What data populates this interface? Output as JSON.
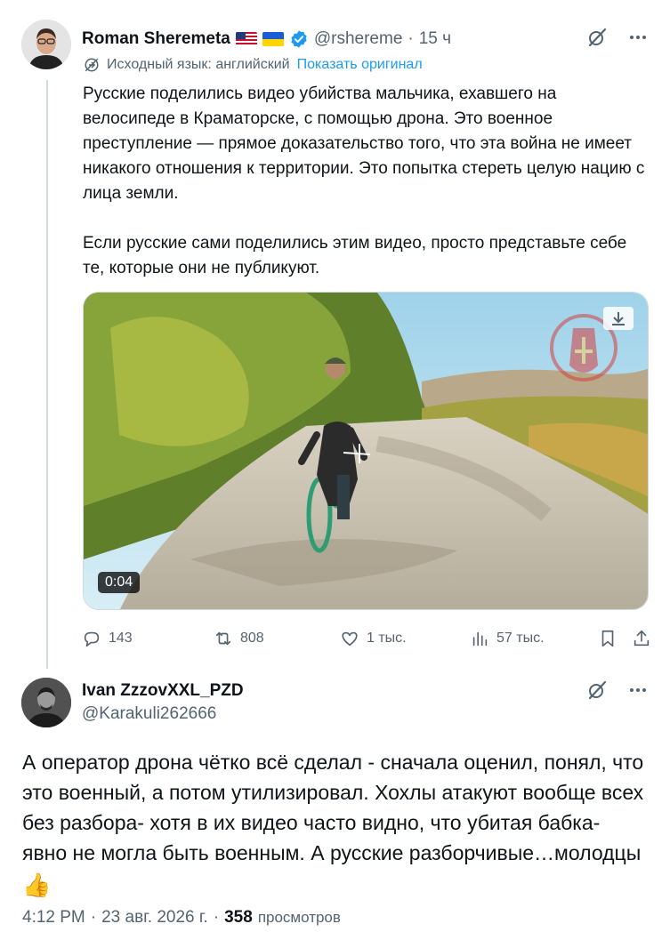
{
  "tweet": {
    "author_name": "Roman Sheremeta",
    "handle": "@rshereme",
    "separator": "·",
    "time_ago": "15 ч",
    "translation_note": "Исходный язык: английский",
    "show_original": "Показать оригинал",
    "paragraphs": [
      "Русские поделились видео убийства мальчика, ехавшего на велосипеде в Краматорске, с помощью дрона. Это военное преступление — прямое доказательство того, что эта война не имеет никакого отношения к территории. Это попытка стереть целую нацию с лица земли.",
      "Если русские сами поделились этим видео, просто представьте себе те, которые они не публикуют."
    ],
    "video_timestamp": "0:04",
    "counts": {
      "replies": "143",
      "reposts": "808",
      "likes": "1 тыс.",
      "views": "57 тыс."
    }
  },
  "reply": {
    "author_name": "Ivan ZzzovXXL_PZD",
    "handle": "@Karakuli262666",
    "text": "А оператор дрона чётко всё сделал - сначала оценил, понял, что это военный, а потом утилизировал. Хохлы атакуют вообще всех без разбора- хотя в их видео часто видно, что убитая бабка- явно не могла быть военным. А русские разборчивые…молодцы",
    "emoji": "👍",
    "time": "4:12 PM",
    "separator": "·",
    "date": "23 авг. 2026 г.",
    "separator2": "·",
    "views_count": "358",
    "views_label": "просмотров"
  },
  "icons": [
    "verified-badge-icon",
    "grok-slash-icon",
    "more-icon",
    "translate-icon",
    "reply-icon",
    "repost-icon",
    "like-icon",
    "views-icon",
    "bookmark-icon",
    "share-icon",
    "download-icon"
  ],
  "colors": {
    "accent": "#1d9bf0",
    "text": "#0f1419",
    "secondary": "#536471",
    "divider": "#cfd9de"
  }
}
